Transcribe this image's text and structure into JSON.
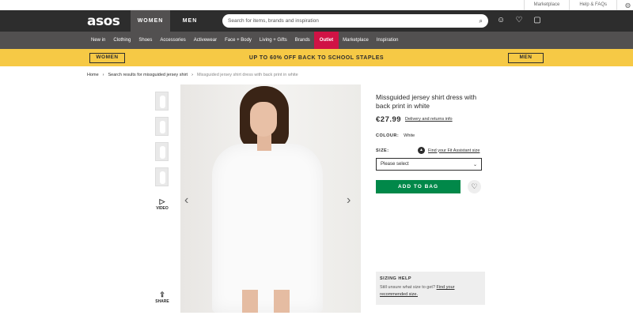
{
  "topstrip": {
    "marketplace": "Marketplace",
    "help": "Help & FAQs"
  },
  "header": {
    "logo": "asos",
    "tabs": [
      {
        "label": "WOMEN"
      },
      {
        "label": "MEN"
      }
    ],
    "search_placeholder": "Search for items, brands and inspiration"
  },
  "categories": [
    "New in",
    "Clothing",
    "Shoes",
    "Accessories",
    "Activewear",
    "Face + Body",
    "Living + Gifts",
    "Brands",
    "Outlet",
    "Marketplace",
    "Inspiration"
  ],
  "promo": {
    "left": "WOMEN",
    "text": "UP TO 60% OFF BACK TO SCHOOL STAPLES",
    "right": "MEN"
  },
  "breadcrumb": {
    "home": "Home",
    "sep": "›",
    "search": "Search results for missguided jersey shirt",
    "sep2": "›",
    "current": "Missguided jersey shirt dress with back print in white"
  },
  "gallery": {
    "video": "VIDEO",
    "share": "SHARE"
  },
  "product": {
    "title": "Missguided jersey shirt dress with back print in white",
    "price": "€27.99",
    "delivery": "Delivery and returns info",
    "colour_label": "COLOUR:",
    "colour_value": "White",
    "size_label": "SIZE:",
    "fit_assistant": "Find your Fit Assistant size",
    "select_placeholder": "Please select",
    "add_to_bag": "ADD TO BAG"
  },
  "sizing": {
    "heading": "SIZING HELP",
    "text": "Still unsure what size to get?",
    "link": "Find your recommended size."
  },
  "colors": {
    "dark": "#2d2d2d",
    "promo": "#f6c945",
    "outlet": "#d01345",
    "bag": "#018849"
  }
}
